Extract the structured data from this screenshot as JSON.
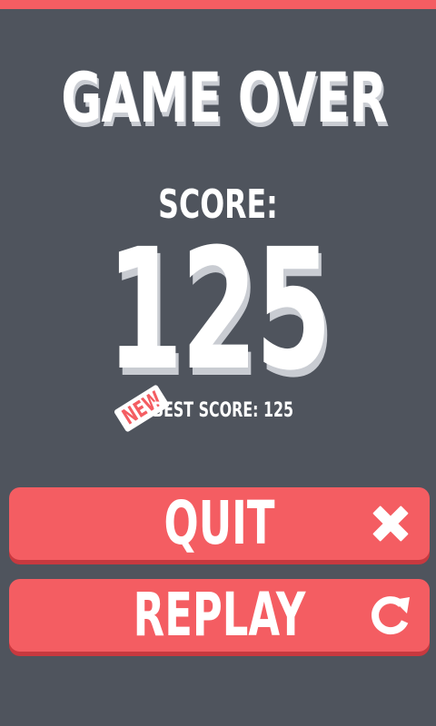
{
  "title": "GAME OVER",
  "score": {
    "label": "SCORE:",
    "value": "125"
  },
  "best": {
    "badge": "NEW",
    "text": "BEST SCORE: 125"
  },
  "buttons": {
    "quit": {
      "label": "QUIT",
      "icon": "close-icon"
    },
    "replay": {
      "label": "REPLAY",
      "icon": "refresh-icon"
    }
  },
  "colors": {
    "background": "#4f545d",
    "accent": "#f45d62",
    "accent_shadow": "#c8393f",
    "text": "#ffffff",
    "text_shadow": "#c9ccd2"
  }
}
